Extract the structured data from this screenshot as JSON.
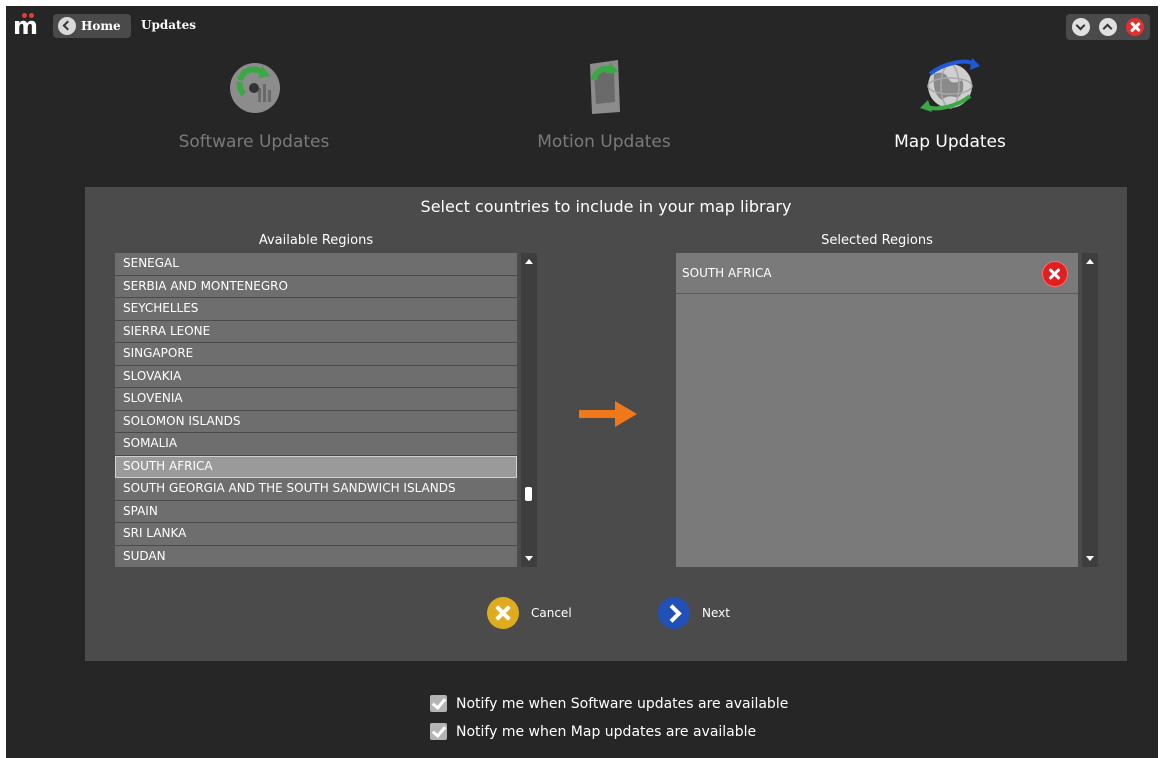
{
  "header": {
    "logo_text": "m",
    "home_label": "Home",
    "breadcrumb": "Updates",
    "controls": [
      "chevron-down-icon",
      "chevron-up-icon",
      "close-icon"
    ]
  },
  "tabs": [
    {
      "label": "Software Updates",
      "icon": "software-update-icon",
      "active": false
    },
    {
      "label": "Motion Updates",
      "icon": "motion-update-icon",
      "active": false
    },
    {
      "label": "Map Updates",
      "icon": "globe-update-icon",
      "active": true
    }
  ],
  "panel": {
    "title": "Select countries to include in your map library",
    "available_header": "Available Regions",
    "selected_header": "Selected Regions",
    "available_regions": [
      "SENEGAL",
      "SERBIA AND MONTENEGRO",
      "SEYCHELLES",
      "SIERRA LEONE",
      "SINGAPORE",
      "SLOVAKIA",
      "SLOVENIA",
      "SOLOMON ISLANDS",
      "SOMALIA",
      "SOUTH AFRICA",
      "SOUTH GEORGIA AND THE SOUTH SANDWICH ISLANDS",
      "SPAIN",
      "SRI LANKA",
      "SUDAN"
    ],
    "highlighted_region": "SOUTH AFRICA",
    "selected_regions": [
      "SOUTH AFRICA"
    ],
    "cancel_label": "Cancel",
    "next_label": "Next"
  },
  "notify": {
    "software_label": "Notify me when Software updates are available",
    "software_checked": true,
    "map_label": "Notify me when Map updates are available",
    "map_checked": true
  },
  "colors": {
    "background": "#262626",
    "panel": "#4b4b4b",
    "accent_arrow": "#f07818",
    "close": "#e23030",
    "cancel": "#e0ac1f",
    "next": "#2150b8"
  }
}
